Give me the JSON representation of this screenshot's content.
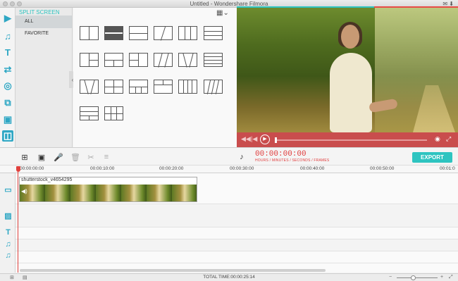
{
  "window": {
    "title": "Untitled - Wondershare Filmora"
  },
  "sidebar_tools": [
    "media-icon",
    "music-icon",
    "text-icon",
    "transitions-icon",
    "filters-icon",
    "overlays-icon",
    "elements-icon",
    "split-screen-icon"
  ],
  "categories": {
    "title": "SPLIT SCREEN",
    "items": [
      {
        "label": "ALL",
        "selected": true
      },
      {
        "label": "FAVORITE",
        "selected": false
      }
    ]
  },
  "templates": {
    "selected_index": 1,
    "count": 20
  },
  "timeline_toolbar": {
    "timecode": "00:00:00:00",
    "timecode_units": "HOURS / MINUTES / SECONDS / FRAMES",
    "export_label": "EXPORT"
  },
  "ruler": {
    "labels": [
      "00:00:00:00",
      "00:00:10:00",
      "00:00:20:00",
      "00:00:30:00",
      "00:00:40:00",
      "00:00:50:00",
      "00:01:0"
    ]
  },
  "timeline": {
    "clip_name": "shutterstock_v4654295"
  },
  "status": {
    "total_time": "TOTAL TIME:00:00:25:14"
  },
  "colors": {
    "accent": "#2ec4c0",
    "tool_blue": "#2fa7c4",
    "record_red": "#e03c3c",
    "preview_bar": "#c94d4d"
  }
}
